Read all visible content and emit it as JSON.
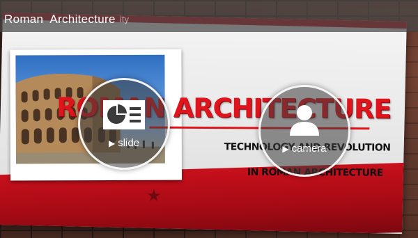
{
  "header": {
    "title": "Roman  Architecture",
    "ghost_text": "ity"
  },
  "slide": {
    "title": "ROMAN ARCHITECTURE",
    "subtitle_line1": "TECHNOLOGY AND REVOLUTION",
    "subtitle_line2": "IN ROMAN ARCHITECTURE",
    "accent_color": "#e0141c",
    "band_color": "#b80d18",
    "photo_subject": "colosseum-photo"
  },
  "buttons": {
    "slide": {
      "label": "slide",
      "icon": "slide-icon",
      "play_icon": "play-icon"
    },
    "camera": {
      "label": "camera",
      "icon": "person-icon",
      "play_icon": "play-icon"
    }
  }
}
